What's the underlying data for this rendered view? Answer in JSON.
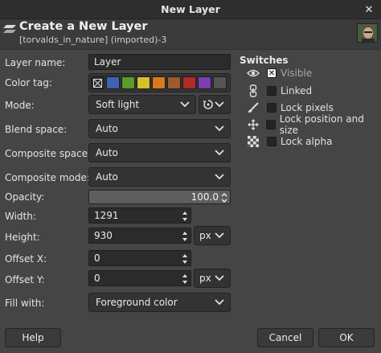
{
  "window": {
    "title": "New Layer"
  },
  "header": {
    "heading": "Create a New Layer",
    "subheading": "[torvalds_in_nature] (imported)-3",
    "icon": "layers-icon"
  },
  "form": {
    "layer_name": {
      "label": "Layer name:",
      "value": "Layer"
    },
    "color_tag": {
      "label": "Color tag:",
      "colors": [
        "none",
        "#3f63b3",
        "#5c9a2c",
        "#d6c12a",
        "#d77a1f",
        "#9e5b2c",
        "#b32a2a",
        "#7b3fb0",
        "#555555"
      ],
      "selected": "none"
    },
    "mode": {
      "label": "Mode:",
      "value": "Soft light"
    },
    "blend_space": {
      "label": "Blend space:",
      "value": "Auto"
    },
    "composite_space": {
      "label": "Composite space:",
      "value": "Auto"
    },
    "composite_mode": {
      "label": "Composite mode:",
      "value": "Auto"
    },
    "opacity": {
      "label": "Opacity:",
      "value": "100.0"
    },
    "width": {
      "label": "Width:",
      "value": "1291"
    },
    "height": {
      "label": "Height:",
      "value": "930",
      "unit": "px"
    },
    "offset_x": {
      "label": "Offset X:",
      "value": "0"
    },
    "offset_y": {
      "label": "Offset Y:",
      "value": "0",
      "unit": "px"
    },
    "fill_with": {
      "label": "Fill with:",
      "value": "Foreground color"
    }
  },
  "switches": {
    "title": "Switches",
    "items": [
      {
        "icon": "eye-icon",
        "label": "Visible",
        "checked": true
      },
      {
        "icon": "chain-link-icon",
        "label": "Linked",
        "checked": false
      },
      {
        "icon": "brush-icon",
        "label": "Lock pixels",
        "checked": false
      },
      {
        "icon": "move-arrows-icon",
        "label": "Lock position and size",
        "checked": false
      },
      {
        "icon": "checkerboard-icon",
        "label": "Lock alpha",
        "checked": false
      }
    ]
  },
  "buttons": {
    "help": "Help",
    "cancel": "Cancel",
    "ok": "OK"
  }
}
